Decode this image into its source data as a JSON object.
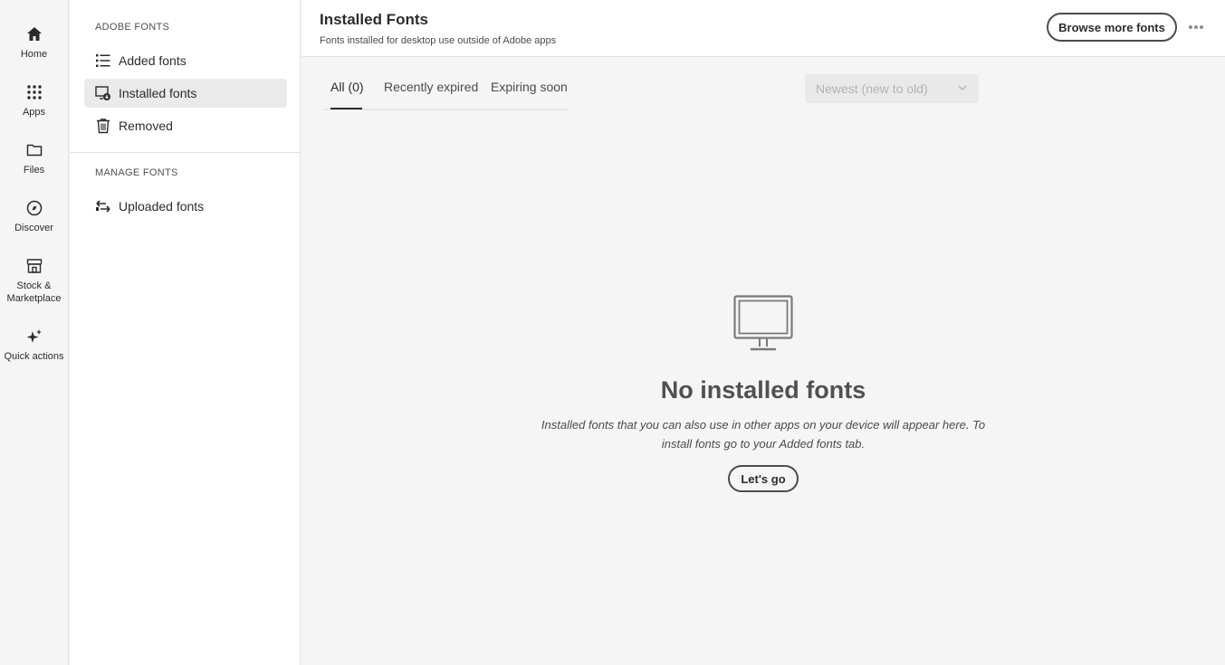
{
  "rail": {
    "items": [
      {
        "label": "Home",
        "icon": "home-icon"
      },
      {
        "label": "Apps",
        "icon": "apps-grid-icon"
      },
      {
        "label": "Files",
        "icon": "folder-icon"
      },
      {
        "label": "Discover",
        "icon": "compass-icon"
      },
      {
        "label": "Stock & Marketplace",
        "icon": "storefront-icon"
      },
      {
        "label": "Quick actions",
        "icon": "sparkle-icon"
      }
    ]
  },
  "subnav": {
    "adobe_fonts_heading": "ADOBE FONTS",
    "manage_fonts_heading": "MANAGE FONTS",
    "items": [
      {
        "label": "Added fonts",
        "icon": "list-icon"
      },
      {
        "label": "Installed fonts",
        "icon": "installed-monitor-icon",
        "active": true
      },
      {
        "label": "Removed",
        "icon": "trash-icon"
      },
      {
        "label": "Uploaded fonts",
        "icon": "swap-arrows-icon"
      }
    ]
  },
  "header": {
    "title": "Installed Fonts",
    "subtitle": "Fonts installed for desktop use outside of Adobe apps",
    "browse_label": "Browse more fonts",
    "more_icon": "ellipsis-icon"
  },
  "tabs": [
    {
      "label": "All (0)",
      "active": true
    },
    {
      "label": "Recently expired"
    },
    {
      "label": "Expiring soon"
    }
  ],
  "sort": {
    "selected": "Newest (new to old)"
  },
  "empty_state": {
    "icon": "monitor-icon",
    "title": "No installed fonts",
    "description": "Installed fonts that you can also use in other apps on your device will appear here. To install fonts go to your Added fonts tab.",
    "button_label": "Let's go"
  },
  "colors": {
    "accent_text": "#2c2c2c",
    "muted": "#b3b3b3",
    "border": "#e1e1e1"
  }
}
